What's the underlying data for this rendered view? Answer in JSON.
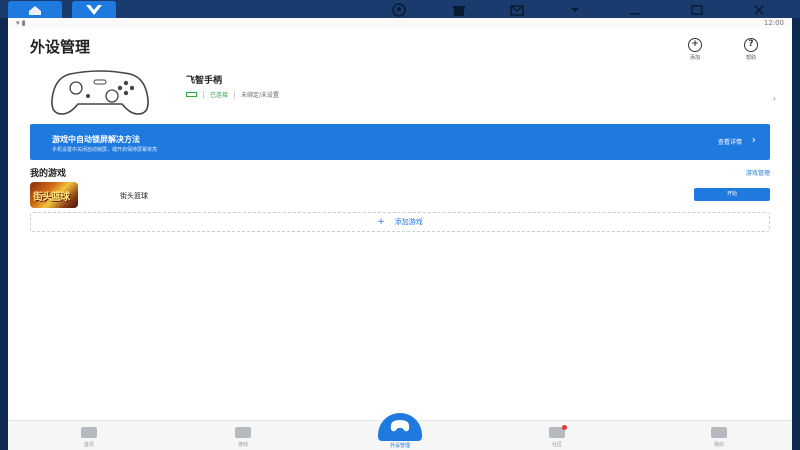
{
  "titlebar": {
    "home_icon": "home-icon",
    "app_icon": "feizhi-logo-icon",
    "right_icons": [
      "account-icon",
      "gift-icon",
      "mail-icon",
      "dropdown-icon",
      "minimize-icon",
      "maximize-icon",
      "close-icon"
    ]
  },
  "status": {
    "time": "12:00"
  },
  "page": {
    "title": "外设管理"
  },
  "actions": [
    {
      "label": "添加",
      "icon": "plus-circle-icon"
    },
    {
      "label": "帮助",
      "icon": "help-circle-icon"
    }
  ],
  "device": {
    "name": "飞智手柄",
    "status": "已连接",
    "mode": "未绑定/未设置",
    "icon": "gamepad-icon"
  },
  "banner": {
    "title": "游戏中自动锁屏解决方法",
    "subtitle": "手机设置中关闭自动锁屏，或开启保持屏幕常亮",
    "link": "查看详情"
  },
  "games": {
    "title": "我的游戏",
    "manage_label": "游戏管理",
    "items": [
      {
        "name": "街头篮球",
        "icon_text": "街头篮球",
        "button": "开始"
      }
    ],
    "add_label": "添加游戏"
  },
  "nav": {
    "items": [
      {
        "label": "首页",
        "icon": "home-nav-icon"
      },
      {
        "label": "游戏",
        "icon": "grid-icon"
      },
      {
        "label": "外设管理",
        "icon": "gamepad-nav-icon",
        "active": true
      },
      {
        "label": "社区",
        "icon": "community-icon",
        "badge": true
      },
      {
        "label": "我的",
        "icon": "profile-icon"
      }
    ]
  },
  "colors": {
    "accent": "#1f7ae0",
    "success": "#2aa745",
    "titlebar": "#1a3b6e"
  }
}
